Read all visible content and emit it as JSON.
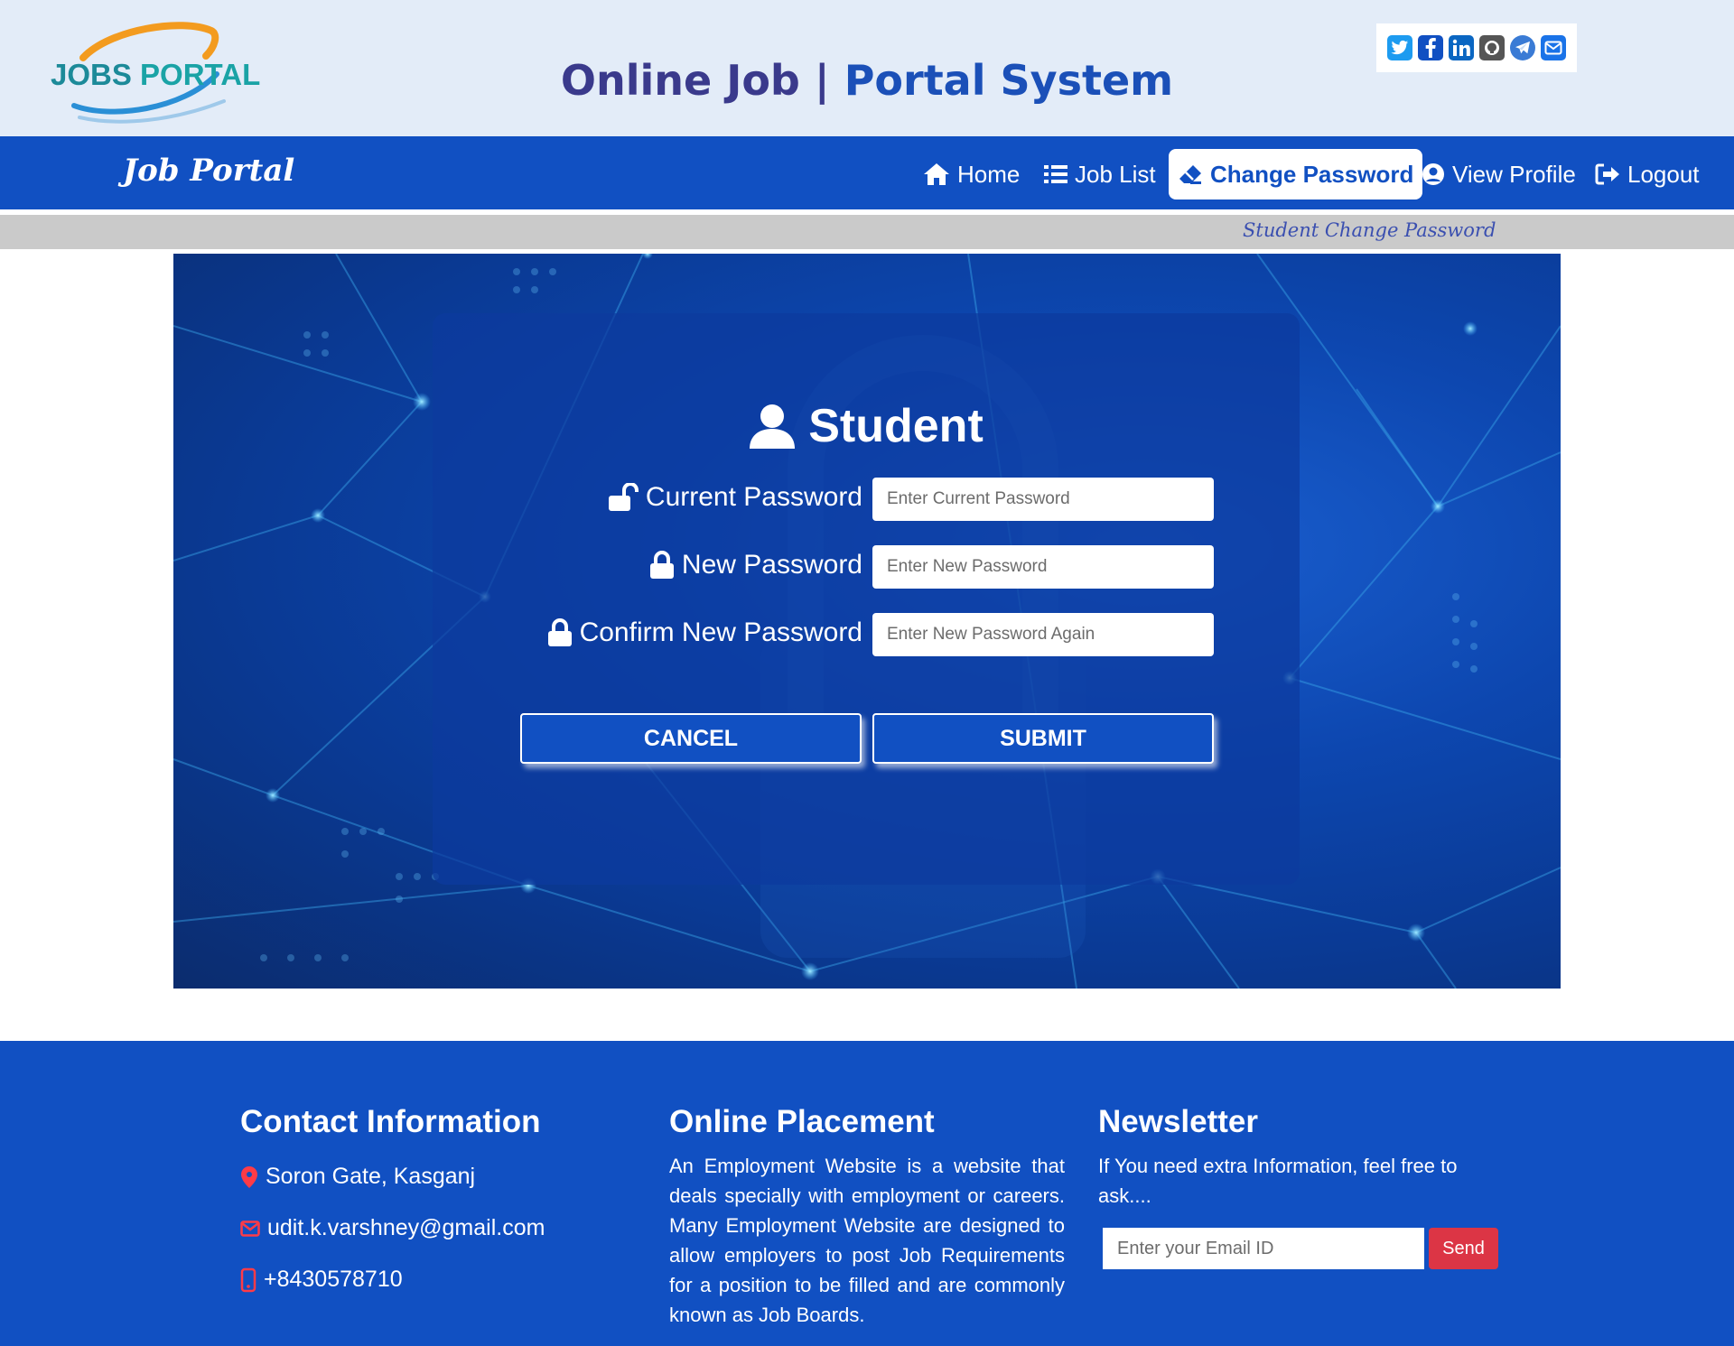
{
  "header": {
    "logo_text_a": "JOBS",
    "logo_text_b": "PORTAL",
    "title_a": "Online Job |",
    "title_b": "Portal System",
    "socials": [
      {
        "icon": "twitter-icon",
        "color": "#1d9bf0"
      },
      {
        "icon": "facebook-icon",
        "color": "#1150c2"
      },
      {
        "icon": "linkedin-icon",
        "color": "#0a66c2"
      },
      {
        "icon": "github-icon",
        "color": "#555555"
      },
      {
        "icon": "telegram-icon",
        "color": "#3a7bd5"
      },
      {
        "icon": "email-icon",
        "color": "#1a73e8"
      }
    ]
  },
  "nav": {
    "brand": "Job Portal",
    "items": [
      {
        "label": "Home",
        "icon": "home-icon"
      },
      {
        "label": "Job List",
        "icon": "list-icon"
      },
      {
        "label": "Change Password",
        "icon": "eraser-icon",
        "active": true
      },
      {
        "label": "View Profile",
        "icon": "user-circle-icon"
      },
      {
        "label": "Logout",
        "icon": "logout-icon"
      }
    ]
  },
  "breadcrumb": "Student Change Password",
  "form": {
    "title": "Student",
    "current_label": "Current Password",
    "current_placeholder": "Enter Current Password",
    "new_label": "New Password",
    "new_placeholder": "Enter New Password",
    "confirm_label": "Confirm New Password",
    "confirm_placeholder": "Enter New Password Again",
    "cancel_label": "CANCEL",
    "submit_label": "SUBMIT"
  },
  "footer": {
    "contact_heading": "Contact Information",
    "address": "Soron Gate, Kasganj",
    "email": "udit.k.varshney@gmail.com",
    "phone": "+8430578710",
    "placement_heading": "Online Placement",
    "placement_text": "An Employment Website is a website that deals specially with employment or careers. Many Employment Website are designed to allow employers to post Job Requirements for a position to be filled and are commonly known as Job Boards.",
    "newsletter_heading": "Newsletter",
    "newsletter_text": "If You need extra Information, feel free to ask....",
    "newsletter_placeholder": "Enter your Email ID",
    "send_label": "Send"
  },
  "colors": {
    "primary": "#1150c2",
    "header_bg": "#e3ecf8",
    "crumb_bar": "#cacaca",
    "send_button": "#dc3545",
    "icon_accent": "#ff3b47"
  }
}
